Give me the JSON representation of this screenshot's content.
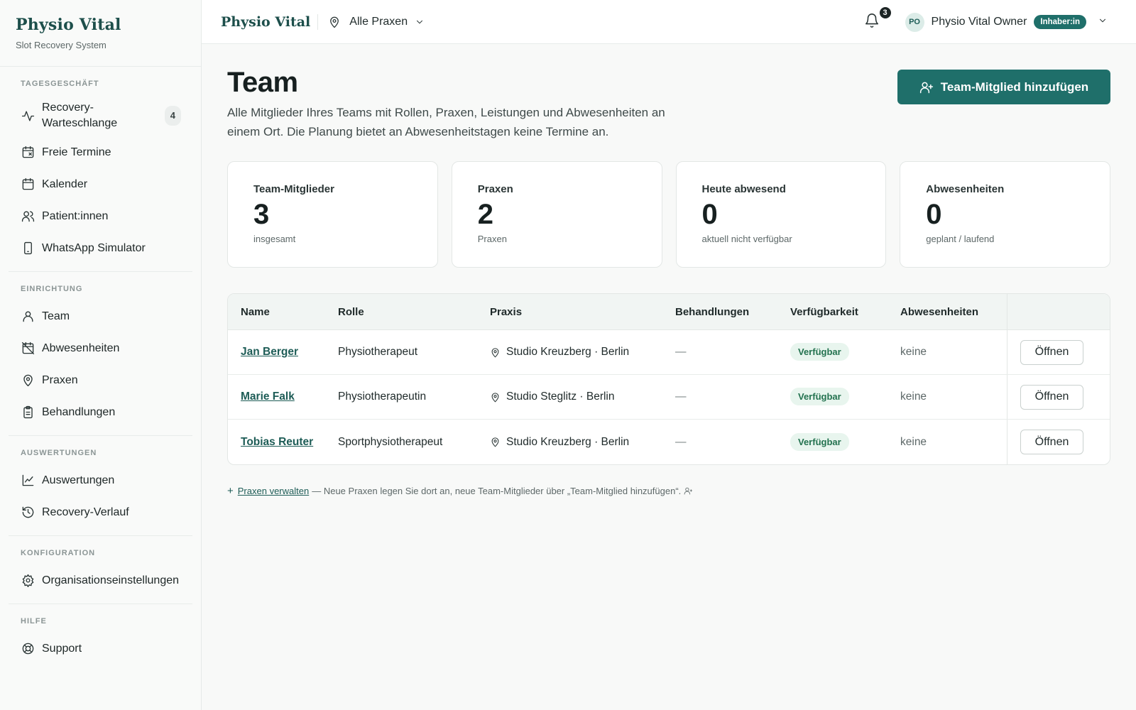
{
  "sidebar": {
    "brand_title": "Physio Vital",
    "brand_subtitle": "Slot Recovery System",
    "sections": [
      {
        "heading": "TAGESGESCHÄFT",
        "items": [
          {
            "label": "Recovery-Warteschlange",
            "icon": "activity-icon",
            "count": "4"
          },
          {
            "label": "Freie Termine",
            "icon": "calendar-x-icon"
          },
          {
            "label": "Kalender",
            "icon": "calendar-icon"
          },
          {
            "label": "Patient:innen",
            "icon": "users-icon"
          },
          {
            "label": "WhatsApp Simulator",
            "icon": "smartphone-icon"
          }
        ]
      },
      {
        "heading": "EINRICHTUNG",
        "items": [
          {
            "label": "Team",
            "icon": "user-icon"
          },
          {
            "label": "Abwesenheiten",
            "icon": "calendar-off-icon"
          },
          {
            "label": "Praxen",
            "icon": "map-pin-icon"
          },
          {
            "label": "Behandlungen",
            "icon": "clipboard-icon"
          }
        ]
      },
      {
        "heading": "AUSWERTUNGEN",
        "items": [
          {
            "label": "Auswertungen",
            "icon": "line-chart-icon"
          },
          {
            "label": "Recovery-Verlauf",
            "icon": "history-icon"
          }
        ]
      },
      {
        "heading": "KONFIGURATION",
        "items": [
          {
            "label": "Organisationseinstellungen",
            "icon": "settings-icon"
          }
        ]
      },
      {
        "heading": "HILFE",
        "items": [
          {
            "label": "Support",
            "icon": "lifebuoy-icon"
          }
        ]
      }
    ]
  },
  "topbar": {
    "brand": "Physio Vital",
    "location_select": "Alle Praxen",
    "notification_count": "3",
    "avatar_initials": "PO",
    "user_name": "Physio Vital Owner",
    "role_badge": "Inhaber:in"
  },
  "main": {
    "title": "Team",
    "description": "Alle Mitglieder Ihres Teams mit Rollen, Praxen, Leistungen und Abwesenheiten an einem Ort. Die Planung bietet an Abwesenheitstagen keine Termine an.",
    "add_button": "Team-Mitglied hinzufügen",
    "stats": [
      {
        "label": "Team-Mitglieder",
        "value": "3",
        "sub": "insgesamt"
      },
      {
        "label": "Praxen",
        "value": "2",
        "sub": "Praxen"
      },
      {
        "label": "Heute abwesend",
        "value": "0",
        "sub": "aktuell nicht verfügbar"
      },
      {
        "label": "Abwesenheiten",
        "value": "0",
        "sub": "geplant / laufend"
      }
    ],
    "table": {
      "headers": {
        "name": "Name",
        "role": "Rolle",
        "practice": "Praxis",
        "treatments": "Behandlungen",
        "availability": "Verfügbarkeit",
        "absences": "Abwesenheiten"
      },
      "rows": [
        {
          "name": "Jan Berger",
          "role": "Physiotherapeut",
          "practice": "Studio Kreuzberg · Berlin",
          "treatments": "—",
          "availability": "Verfügbar",
          "absences": "keine",
          "action": "Öffnen"
        },
        {
          "name": "Marie Falk",
          "role": "Physiotherapeutin",
          "practice": "Studio Steglitz · Berlin",
          "treatments": "—",
          "availability": "Verfügbar",
          "absences": "keine",
          "action": "Öffnen"
        },
        {
          "name": "Tobias Reuter",
          "role": "Sportphysiotherapeut",
          "practice": "Studio Kreuzberg · Berlin",
          "treatments": "—",
          "availability": "Verfügbar",
          "absences": "keine",
          "action": "Öffnen"
        }
      ]
    },
    "footnote": {
      "link": "Praxen verwalten",
      "text": "— Neue Praxen legen Sie dort an, neue Team-Mitglieder über „Team-Mitglied hinzufügen“."
    }
  },
  "colors": {
    "accent": "#1f6f6a",
    "brand": "#1d4f4b",
    "available_bg": "#e8f5ee",
    "available_text": "#23724f"
  }
}
